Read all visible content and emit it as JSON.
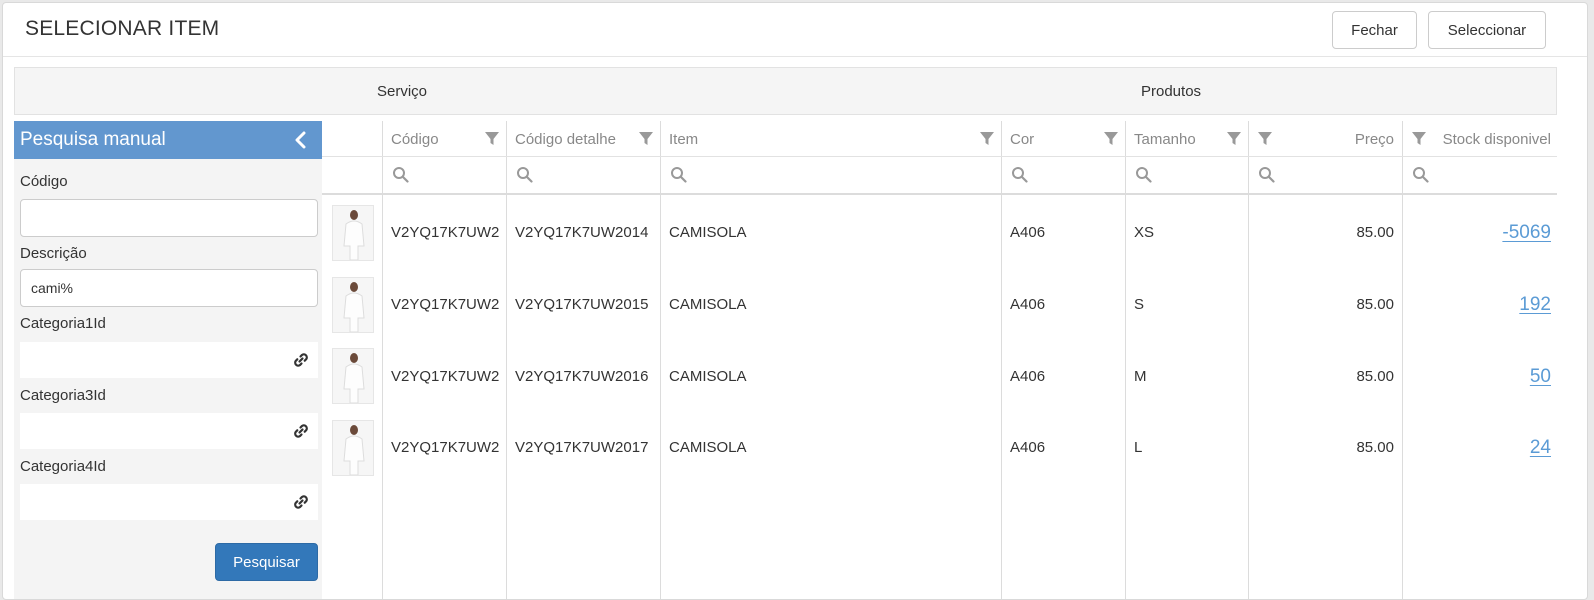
{
  "header": {
    "title": "SELECIONAR ITEM",
    "close_label": "Fechar",
    "select_label": "Seleccionar"
  },
  "tabs": {
    "servico": "Serviço",
    "produtos": "Produtos"
  },
  "panel": {
    "title": "Pesquisa manual",
    "fields": {
      "codigo": {
        "label": "Código",
        "value": ""
      },
      "descricao": {
        "label": "Descrição",
        "value": "cami%"
      },
      "categoria1": {
        "label": "Categoria1Id"
      },
      "categoria3": {
        "label": "Categoria3Id"
      },
      "categoria4": {
        "label": "Categoria4Id"
      }
    },
    "search_label": "Pesquisar"
  },
  "grid": {
    "columns": [
      "Código",
      "Código detalhe",
      "Item",
      "Cor",
      "Tamanho",
      "Preço",
      "Stock disponivel"
    ],
    "rows": [
      {
        "codigo": "V2YQ17K7UW2",
        "detalhe": "V2YQ17K7UW2014",
        "item": "CAMISOLA",
        "cor": "A406",
        "tamanho": "XS",
        "preco": "85.00",
        "stock": "-5069"
      },
      {
        "codigo": "V2YQ17K7UW2",
        "detalhe": "V2YQ17K7UW2015",
        "item": "CAMISOLA",
        "cor": "A406",
        "tamanho": "S",
        "preco": "85.00",
        "stock": "192"
      },
      {
        "codigo": "V2YQ17K7UW2",
        "detalhe": "V2YQ17K7UW2016",
        "item": "CAMISOLA",
        "cor": "A406",
        "tamanho": "M",
        "preco": "85.00",
        "stock": "50"
      },
      {
        "codigo": "V2YQ17K7UW2",
        "detalhe": "V2YQ17K7UW2017",
        "item": "CAMISOLA",
        "cor": "A406",
        "tamanho": "L",
        "preco": "85.00",
        "stock": "24"
      }
    ]
  },
  "colors": {
    "accent": "#6297cf",
    "primary_button": "#3378ba",
    "link": "#5b9bd5"
  },
  "icons": {
    "collapse": "chevron-left-icon",
    "filter": "filter-icon",
    "search": "search-icon",
    "lookup": "link-icon"
  }
}
